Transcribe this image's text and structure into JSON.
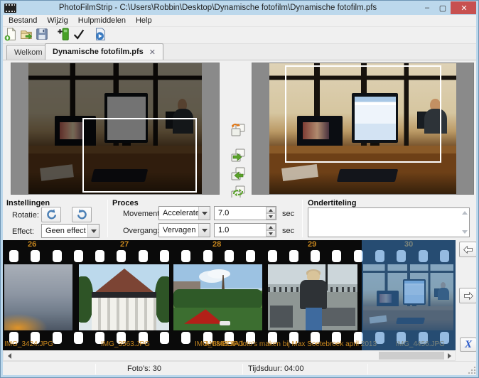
{
  "window": {
    "title": "PhotoFilmStrip - C:\\Users\\Robbin\\Desktop\\Dynamische fotofilm\\Dynamische fotofilm.pfs",
    "minimize": "–",
    "maximize": "▢",
    "close": "✕"
  },
  "menu": {
    "items": [
      {
        "label": "Bestand"
      },
      {
        "label": "Wijzig"
      },
      {
        "label": "Hulpmiddelen"
      },
      {
        "label": "Help"
      }
    ]
  },
  "toolbar": {
    "buttons": [
      {
        "icon": "new-project-icon"
      },
      {
        "icon": "open-project-icon"
      },
      {
        "icon": "save-project-icon"
      },
      {
        "icon": "import-pictures-icon"
      },
      {
        "icon": "render-check-icon"
      },
      {
        "icon": "start-render-icon"
      }
    ]
  },
  "tabs": [
    {
      "label": "Welkom",
      "active": false
    },
    {
      "label": "Dynamische fotofilm.pfs",
      "active": true,
      "close": "✕"
    }
  ],
  "editor": {
    "tool_buttons": [
      {
        "icon": "swap-start-end-icon"
      },
      {
        "icon": "copy-start-to-end-icon"
      },
      {
        "icon": "copy-end-to-start-icon"
      },
      {
        "icon": "reset-motion-icon"
      },
      {
        "icon": "adjust-motion-icon"
      },
      {
        "icon": "lock-aspect-icon",
        "disabled": true
      }
    ]
  },
  "settings": {
    "heading": "Instellingen",
    "rotate_label": "Rotatie:",
    "effect_label": "Effect:",
    "effect_value": "Geen effect"
  },
  "process": {
    "heading": "Proces",
    "movement_label": "Movement:",
    "movement_value": "Accelerated",
    "movement_duration": "7.0",
    "movement_unit": "sec",
    "transition_label": "Overgang:",
    "transition_value": "Vervagen",
    "transition_duration": "1.0",
    "transition_unit": "sec"
  },
  "subtitle": {
    "heading": "Ondertiteling",
    "value": ""
  },
  "filmstrip": {
    "frames": [
      {
        "number": "26",
        "filename": "IMG_3424.JPG",
        "selected": false
      },
      {
        "number": "27",
        "filename": "IMG_3563.JPG",
        "selected": false
      },
      {
        "number": "28",
        "filename": "IMG_5844.JPG",
        "selected": false
      },
      {
        "number": "29",
        "filename": "ANIMEDIA foto's maken bij Max Soetebroek april 2013",
        "selected": false
      },
      {
        "number": "30",
        "filename": "IMG_4456.JPG",
        "selected": true
      }
    ]
  },
  "statusbar": {
    "photos": "Foto's: 30",
    "duration": "Tijdsduur: 04:00"
  },
  "colors": {
    "titlebar": "#bcd8ec",
    "close_button": "#c75050",
    "selection": "#3e84c8",
    "filmstrip_text": "#c8871e"
  }
}
